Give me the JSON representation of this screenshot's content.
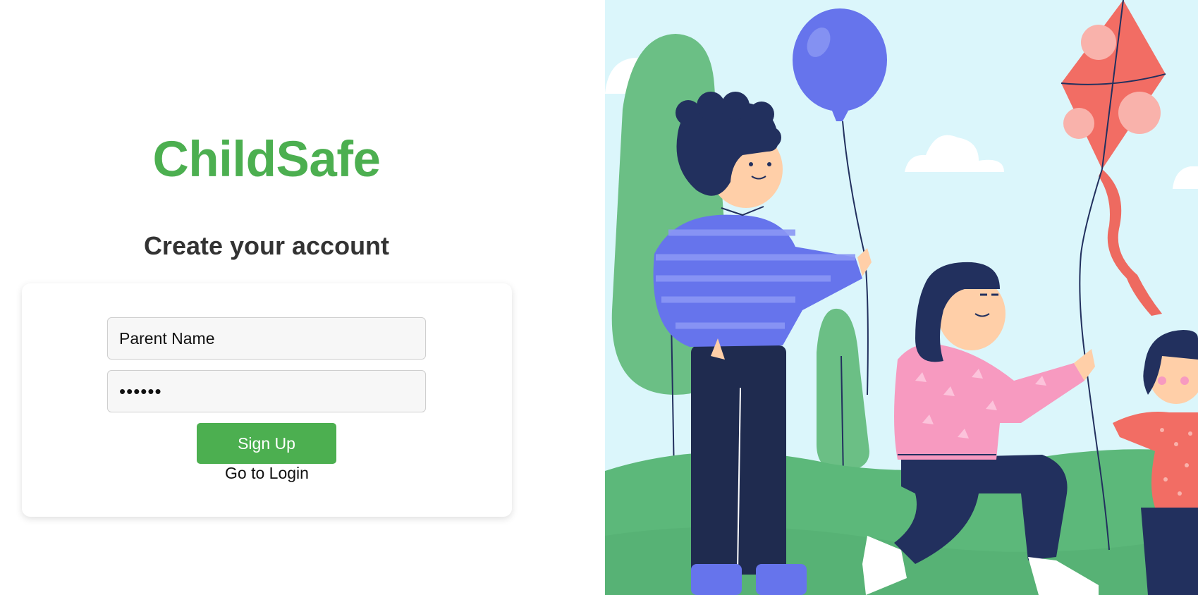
{
  "brand": {
    "title": "ChildSafe"
  },
  "form": {
    "heading": "Create your account",
    "name_placeholder": "Parent Name",
    "name_value": "",
    "password_value": "••••••",
    "signup_label": "Sign Up",
    "login_link": "Go to Login"
  },
  "colors": {
    "brand": "#4caf50",
    "sky": "#dbf6fb",
    "grass": "#5cb87a",
    "balloon": "#6674ec",
    "kite": "#f26d64",
    "navy": "#22305e",
    "pink": "#f79ac0"
  },
  "illustration": {
    "subject": "family-playing-outdoors-illustration",
    "icons": [
      "balloon-icon",
      "kite-icon",
      "tree-icon",
      "cloud-icon"
    ]
  }
}
